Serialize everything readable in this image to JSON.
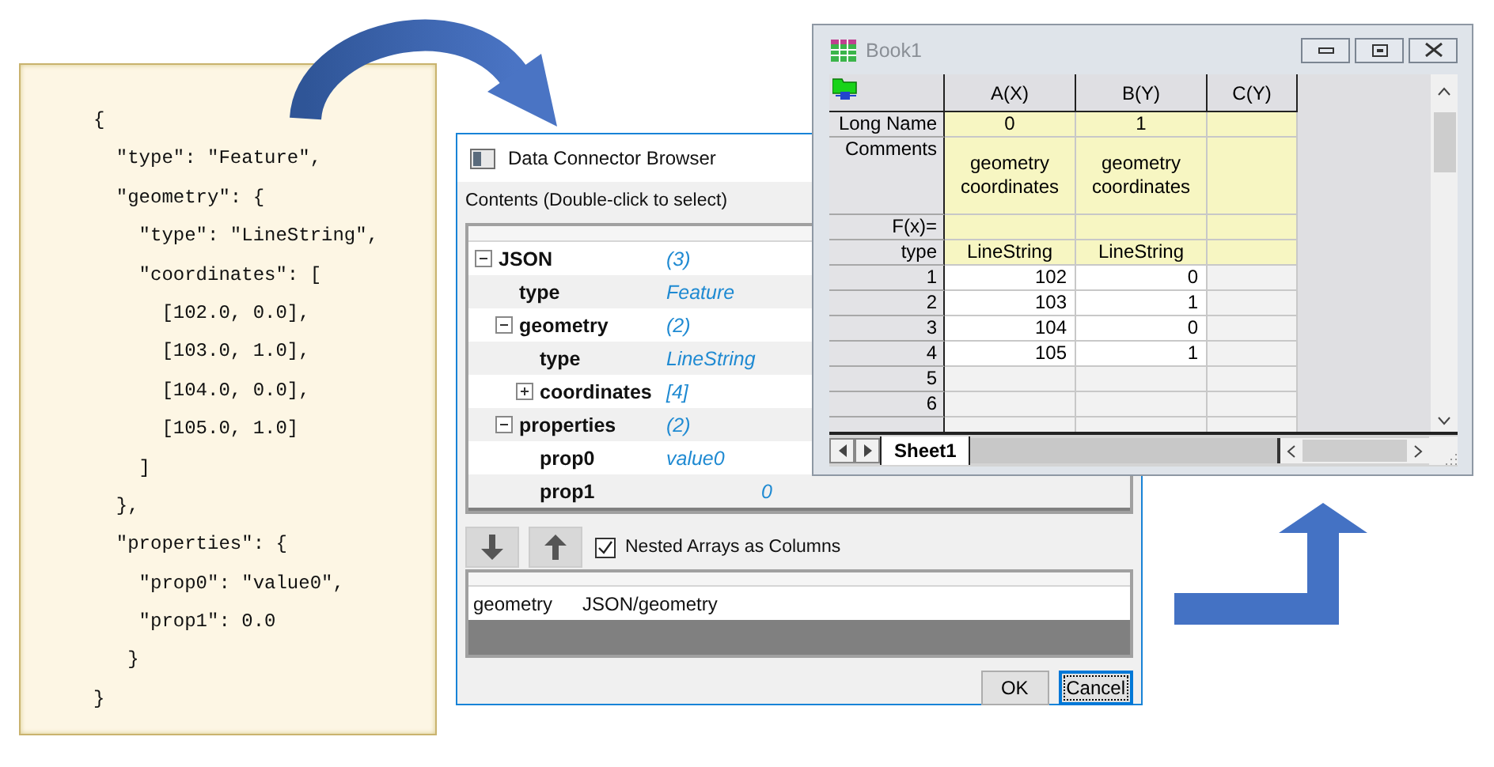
{
  "code_panel": {
    "lines": [
      "{",
      "  \"type\": \"Feature\",",
      "  \"geometry\": {",
      "    \"type\": \"LineString\",",
      "    \"coordinates\": [",
      "      [102.0, 0.0],",
      "      [103.0, 1.0],",
      "      [104.0, 0.0],",
      "      [105.0, 1.0]",
      "    ]",
      "  },",
      "  \"properties\": {",
      "    \"prop0\": \"value0\",",
      "    \"prop1\": 0.0",
      "   }",
      "}"
    ]
  },
  "dialog": {
    "title": "Data Connector Browser",
    "contents_label": "Contents (Double-click to select)",
    "tree": [
      {
        "name": "JSON",
        "value": "(3)",
        "expanded": true,
        "children": [
          {
            "name": "type",
            "value": "Feature"
          },
          {
            "name": "geometry",
            "value": "(2)",
            "expanded": true,
            "children": [
              {
                "name": "type",
                "value": "LineString"
              },
              {
                "name": "coordinates",
                "value": "[4]",
                "expanded": false
              }
            ]
          },
          {
            "name": "properties",
            "value": "(2)",
            "expanded": true,
            "children": [
              {
                "name": "prop0",
                "value": "value0"
              },
              {
                "name": "prop1",
                "value": "0",
                "kind": "number"
              }
            ]
          }
        ]
      }
    ],
    "nested_arrays": {
      "label": "Nested Arrays as Columns",
      "checked": true
    },
    "selection_list": [
      {
        "column_1": "geometry",
        "column_2": "JSON/geometry"
      }
    ],
    "buttons": [
      {
        "label": "OK",
        "focused": false
      },
      {
        "label": "Cancel",
        "focused": true
      }
    ]
  },
  "workbook": {
    "title": "Book1",
    "columns": [
      "A(X)",
      "B(Y)",
      "C(Y)"
    ],
    "header_rows": [
      {
        "label": "Long Name",
        "cells": [
          "0",
          "1"
        ]
      },
      {
        "label": "Comments",
        "cells": [
          "geometry coordinates",
          "geometry coordinates"
        ],
        "kind": "tall"
      },
      {
        "label": "F(x)="
      },
      {
        "label": "type",
        "cells": [
          "LineString",
          "LineString"
        ]
      }
    ],
    "rows": [
      {
        "label": "1",
        "cells": [
          "102",
          "0"
        ]
      },
      {
        "label": "2",
        "cells": [
          "103",
          "1"
        ]
      },
      {
        "label": "3",
        "cells": [
          "104",
          "0"
        ]
      },
      {
        "label": "4",
        "cells": [
          "105",
          "1"
        ]
      },
      {
        "label": "5"
      },
      {
        "label": "6"
      }
    ],
    "sheet_tabs": [
      {
        "label": "Sheet1",
        "selected": true
      }
    ]
  }
}
